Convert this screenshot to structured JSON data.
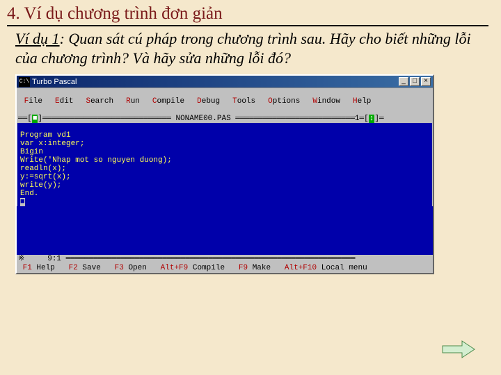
{
  "heading": "4. Ví dụ chương trình đơn giản",
  "desc_label": "Ví dụ 1",
  "desc_rest": ": Quan sát cú pháp trong chương trình sau. Hãy cho biết những lỗi của chương trình? Và  hãy sửa những lỗi đó?",
  "window": {
    "icon": "C:\\",
    "title": "Turbo Pascal",
    "min": "_",
    "restore": "□",
    "close": "×"
  },
  "menu": {
    "file": "File",
    "edit": "Edit",
    "search": "Search",
    "run": "Run",
    "compile": "Compile",
    "debug": "Debug",
    "tools": "Tools",
    "options": "Options",
    "window": "Window",
    "help": "Help"
  },
  "frame": {
    "left": "══[",
    "leftmark": "■",
    "fill1": "]════════════════════════════ ",
    "filename": "NONAME00.PAS",
    "fill2": " ══════════════════════════1═[",
    "rightmark": "↕",
    "right": "]═"
  },
  "code": {
    "l1": "Program vd1",
    "l2": "var x:integer;",
    "l3": "Bigin",
    "l4": "Write('Nhap mot so nguyen duong);",
    "l5": "readln(x);",
    "l6": "y:=sqrt(x);",
    "l7": "write(y);",
    "l8": "End.",
    "l9": "■"
  },
  "status": {
    "marker": "※",
    "pos": "     9:1 ═══",
    "fill": "════════════════════════════════════════════════════════════"
  },
  "bottom": {
    "f1k": "F1",
    "f1t": " Help   ",
    "f2k": "F2",
    "f2t": " Save   ",
    "f3k": "F3",
    "f3t": " Open   ",
    "af9k": "Alt+F9",
    "af9t": " Compile   ",
    "f9k": "F9",
    "f9t": " Make   ",
    "af10k": "Alt+F10",
    "af10t": " Local menu"
  }
}
